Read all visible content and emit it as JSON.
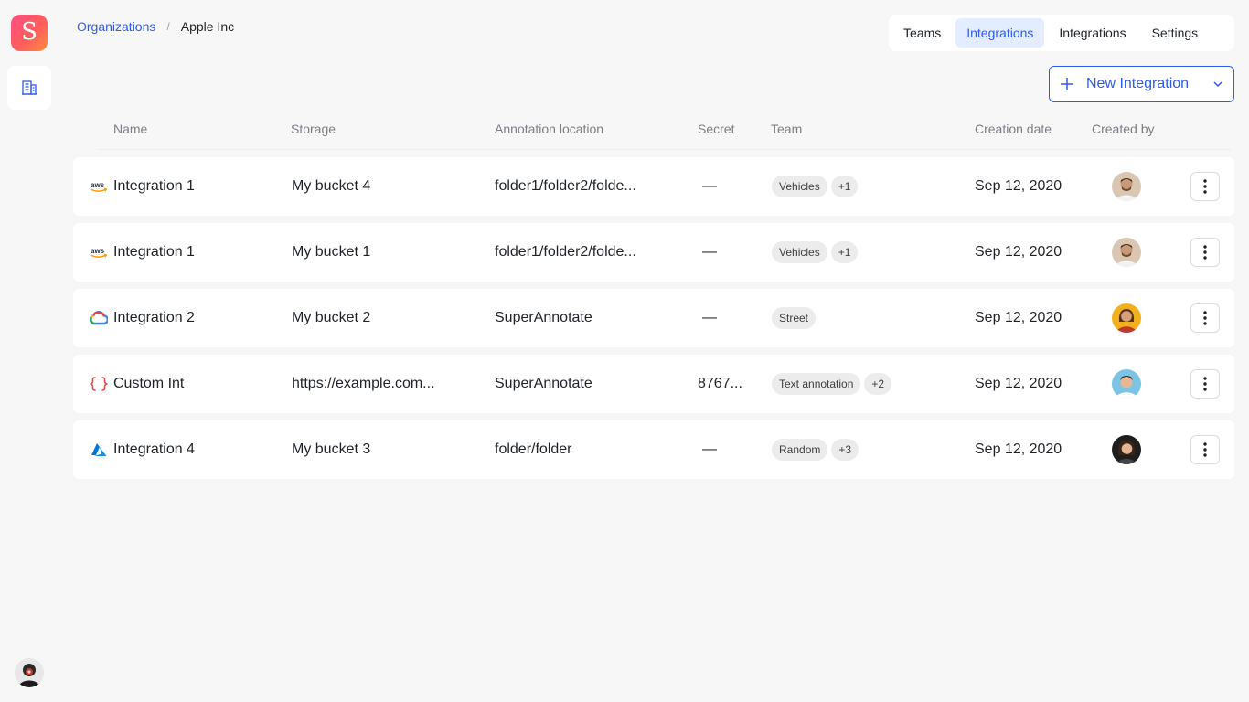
{
  "app": {
    "logo_letter": "S"
  },
  "breadcrumb": {
    "parent": "Organizations",
    "separator": "/",
    "current": "Apple Inc"
  },
  "tabs": [
    {
      "label": "Teams",
      "active": false
    },
    {
      "label": "Integrations",
      "active": true
    },
    {
      "label": "Integrations",
      "active": false
    },
    {
      "label": "Settings",
      "active": false
    }
  ],
  "new_button": {
    "label": "New Integration"
  },
  "table": {
    "headers": {
      "name": "Name",
      "storage": "Storage",
      "location": "Annotation location",
      "secret": "Secret",
      "team": "Team",
      "date": "Creation date",
      "created_by": "Created by"
    },
    "rows": [
      {
        "provider": "aws",
        "name": "Integration 1",
        "storage": "My bucket 4",
        "location": "folder1/folder2/folde...",
        "secret": "—",
        "team": "Vehicles",
        "team_more": "+1",
        "date": "Sep 12, 2020",
        "avatar": "man-beige"
      },
      {
        "provider": "aws",
        "name": "Integration 1",
        "storage": "My bucket 1",
        "location": "folder1/folder2/folde...",
        "secret": "—",
        "team": "Vehicles",
        "team_more": "+1",
        "date": "Sep 12, 2020",
        "avatar": "man-beige"
      },
      {
        "provider": "gcp",
        "name": "Integration 2",
        "storage": "My bucket 2",
        "location": "SuperAnnotate",
        "secret": "—",
        "team": "Street",
        "team_more": "",
        "date": "Sep 12, 2020",
        "avatar": "woman-yellow"
      },
      {
        "provider": "custom",
        "name": "Custom Int",
        "storage": "https://example.com...",
        "location": "SuperAnnotate",
        "secret": "8767...",
        "team": "Text annotation",
        "team_more": "+2",
        "date": "Sep 12, 2020",
        "avatar": "man-blue"
      },
      {
        "provider": "azure",
        "name": "Integration 4",
        "storage": "My bucket 3",
        "location": "folder/folder",
        "secret": "—",
        "team": "Random",
        "team_more": "+3",
        "date": "Sep 12, 2020",
        "avatar": "woman-dark"
      }
    ]
  },
  "colors": {
    "accent": "#2f5bea",
    "active_tab_bg": "#e4ecff",
    "background": "#f7f7f7"
  }
}
